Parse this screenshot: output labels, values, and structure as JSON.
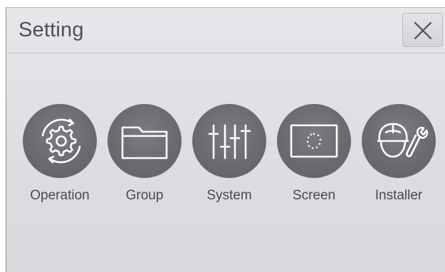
{
  "header": {
    "title": "Setting",
    "close_icon": "close-icon"
  },
  "menu": {
    "items": [
      {
        "label": "Operation",
        "icon": "operation-gear-icon"
      },
      {
        "label": "Group",
        "icon": "folder-icon"
      },
      {
        "label": "System",
        "icon": "sliders-icon"
      },
      {
        "label": "Screen",
        "icon": "screen-icon"
      },
      {
        "label": "Installer",
        "icon": "installer-wrench-icon"
      }
    ]
  },
  "colors": {
    "background": "#dcdde1",
    "icon_circle": "#6a6a71",
    "icon_stroke": "#ffffff",
    "text": "#4a4a4e"
  }
}
